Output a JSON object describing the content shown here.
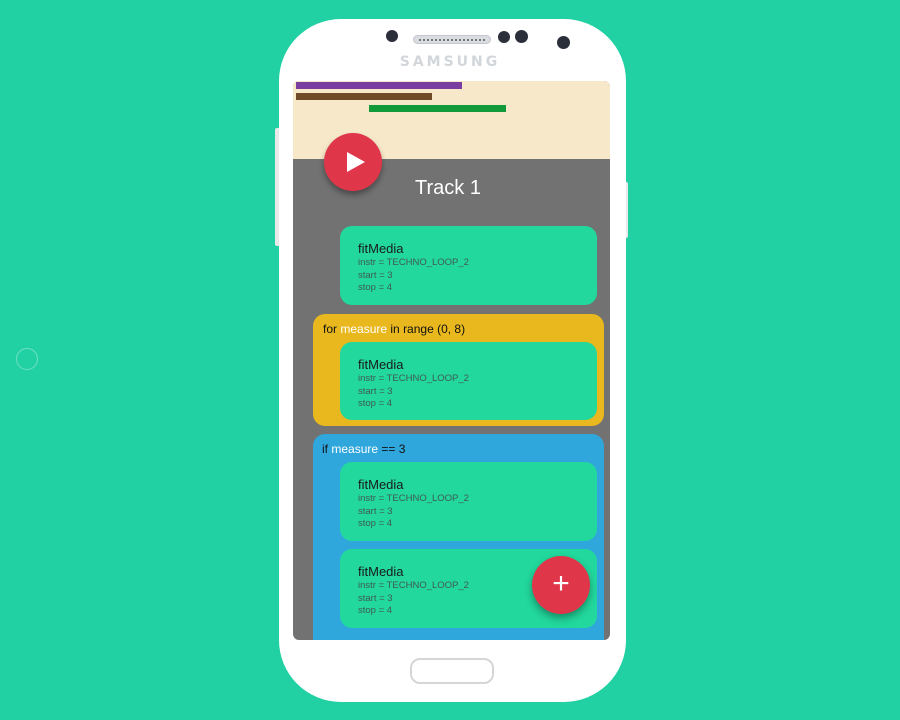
{
  "device": {
    "brand": "SAMSUNG"
  },
  "timeline": {
    "bars": [
      {
        "color": "#7a3ea0"
      },
      {
        "color": "#6e4a26"
      },
      {
        "color": "#129a3a"
      }
    ]
  },
  "track": {
    "title": "Track 1"
  },
  "blocks": {
    "standalone": {
      "fn": "fitMedia",
      "instr": "instr = TECHNO_LOOP_2",
      "start": "start = 3",
      "stop": "stop = 4"
    },
    "loop": {
      "kw_for": "for",
      "var": "measure",
      "kw_in": "in range (0, 8)",
      "inner": {
        "fn": "fitMedia",
        "instr": "instr = TECHNO_LOOP_2",
        "start": "start = 3",
        "stop": "stop = 4"
      }
    },
    "cond": {
      "kw_if": "if",
      "var": "measure",
      "op": "== 3",
      "inner1": {
        "fn": "fitMedia",
        "instr": "instr = TECHNO_LOOP_2",
        "start": "start = 3",
        "stop": "stop = 4"
      },
      "inner2": {
        "fn": "fitMedia",
        "instr": "instr = TECHNO_LOOP_2",
        "start": "start = 3",
        "stop": "stop = 4"
      }
    }
  },
  "fab": {
    "label": "+"
  },
  "colors": {
    "background": "#22d1a3",
    "accent": "#e0364a",
    "loop": "#e8b81e",
    "cond": "#2fa6dc",
    "block": "#22d89c"
  }
}
